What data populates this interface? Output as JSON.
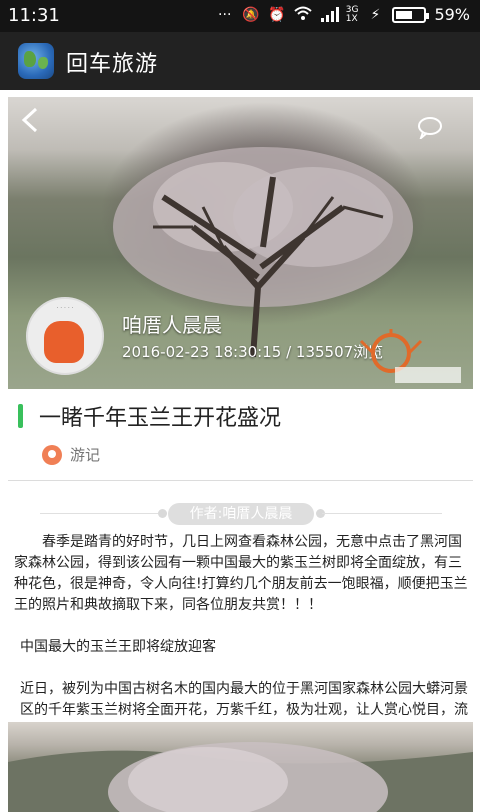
{
  "status": {
    "time": "11:31",
    "network": "3G",
    "network_sub": "1X",
    "battery": "59%"
  },
  "app": {
    "title": "回车旅游"
  },
  "hero": {
    "author": "咱厝人晨晨",
    "meta": "2016-02-23 18:30:15 / 135507浏览"
  },
  "article": {
    "title": "一睹千年玉兰王开花盛况",
    "category": "游记",
    "byline": "作者:咱厝人晨晨",
    "paragraphs": [
      "春季是踏青的好时节，几日上网查看森林公园，无意中点击了黑河国家森林公园，得到该公园有一颗中国最大的紫玉兰树即将全面绽放，有三种花色，很是神奇，令人向往!打算约几个朋友前去一饱眼福，顺便把玉兰王的照片和典故摘取下来，同各位朋友共赏！！！",
      "中国最大的玉兰王即将绽放迎客",
      "近日，被列为中国古树名木的国内最大的位于黑河国家森林公园大蟒河景区的千年紫玉兰树将全面开花，万紫千红，极为壮观，让人赏心悦目，流连忘返。"
    ]
  },
  "colors": {
    "accent_green": "#39c05c",
    "pin_orange": "#f07f55",
    "appbar": "#222222"
  },
  "icons": [
    "back-arrow-icon",
    "comment-icon",
    "location-pin-icon"
  ]
}
